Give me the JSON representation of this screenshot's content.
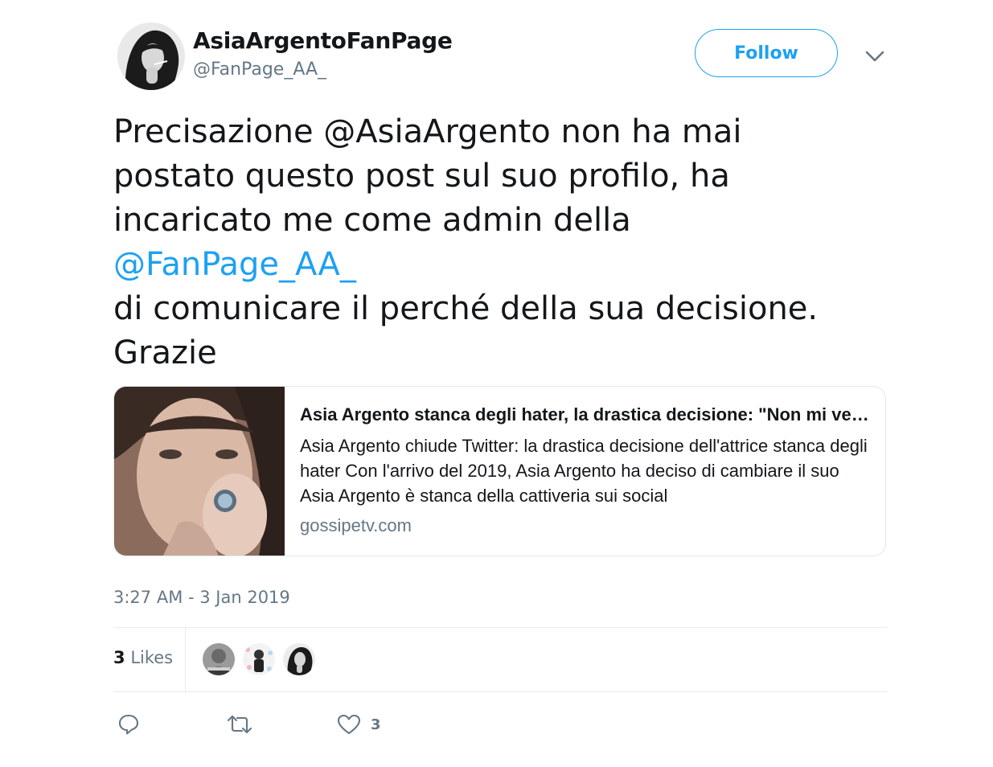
{
  "author": {
    "display_name": "AsiaArgentoFanPage",
    "handle": "@FanPage_AA_"
  },
  "follow_label": "Follow",
  "tweet": {
    "lines": [
      "Precisazione @AsiaArgento non ha mai",
      "postato questo post sul suo profilo, ha",
      "incaricato me come admin della"
    ],
    "mention": "@FanPage_AA_",
    "lines_after": [
      "di comunicare il perché della sua decisione.",
      "Grazie"
    ]
  },
  "card": {
    "title": "Asia Argento stanca degli hater, la drastica decisione: \"Non mi vedrete più qui\"",
    "description": "Asia Argento chiude Twitter: la drastica decisione dell'attrice stanca degli hater Con l'arrivo del 2019, Asia Argento ha deciso di cambiare il suo Asia Argento è stanca della cattiveria sui social",
    "domain": "gossipetv.com"
  },
  "timestamp": "3:27 AM - 3 Jan 2019",
  "stats": {
    "likes_count": "3",
    "likes_label": "Likes"
  },
  "actions": {
    "like_count": "3"
  },
  "icons": {
    "caret": "chevron-down-icon",
    "reply": "reply-icon",
    "retweet": "retweet-icon",
    "like": "heart-icon"
  },
  "colors": {
    "link": "#1da1f2",
    "secondary_text": "#657786",
    "border": "#e1e8ed"
  }
}
